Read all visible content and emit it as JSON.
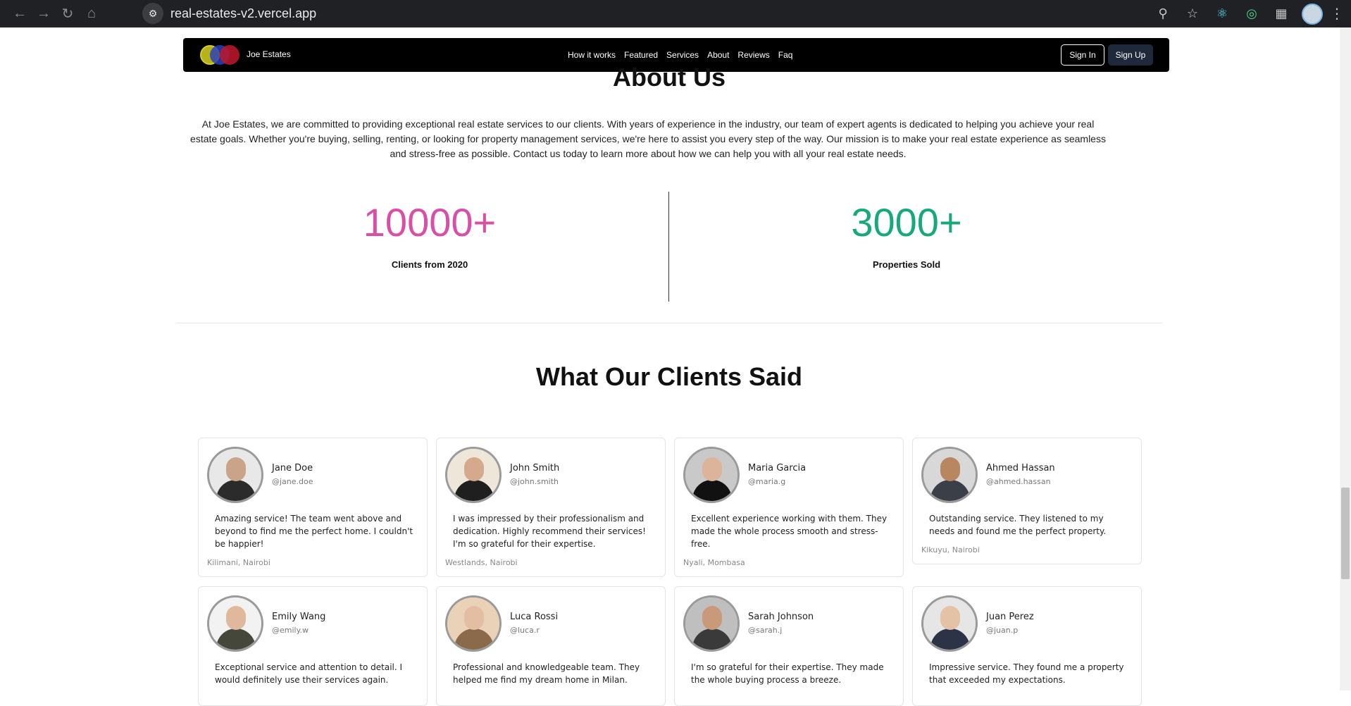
{
  "browser": {
    "url": "real-estates-v2.vercel.app"
  },
  "navbar": {
    "brand": "Joe Estates",
    "links": [
      "How it works",
      "Featured",
      "Services",
      "About",
      "Reviews",
      "Faq"
    ],
    "sign_in": "Sign In",
    "sign_up": "Sign Up"
  },
  "about": {
    "title": "About Us",
    "text": "At Joe Estates, we are committed to providing exceptional real estate services to our clients. With years of experience in the industry, our team of expert agents is dedicated to helping you achieve your real estate goals. Whether you're buying, selling, renting, or looking for property management services, we're here to assist you every step of the way. Our mission is to make your real estate experience as seamless and stress-free as possible. Contact us today to learn more about how we can help you with all your real estate needs.",
    "stats": [
      {
        "value": "10000+",
        "label": "Clients from 2020",
        "color": "#d94fa6"
      },
      {
        "value": "3000+",
        "label": "Properties Sold",
        "color": "#17a97a"
      }
    ]
  },
  "reviews": {
    "title": "What Our Clients Said",
    "items": [
      {
        "name": "Jane Doe",
        "handle": "@jane.doe",
        "quote": "Amazing service! The team went above and beyond to find me the perfect home. I couldn't be happier!",
        "location": "Kilimani, Nairobi"
      },
      {
        "name": "John Smith",
        "handle": "@john.smith",
        "quote": "I was impressed by their professionalism and dedication. Highly recommend their services! I'm so grateful for their expertise.",
        "location": "Westlands, Nairobi"
      },
      {
        "name": "Maria Garcia",
        "handle": "@maria.g",
        "quote": "Excellent experience working with them. They made the whole process smooth and stress-free.",
        "location": "Nyali, Mombasa"
      },
      {
        "name": "Ahmed Hassan",
        "handle": "@ahmed.hassan",
        "quote": "Outstanding service. They listened to my needs and found me the perfect property.",
        "location": "Kikuyu, Nairobi"
      },
      {
        "name": "Emily Wang",
        "handle": "@emily.w",
        "quote": "Exceptional service and attention to detail. I would definitely use their services again.",
        "location": ""
      },
      {
        "name": "Luca Rossi",
        "handle": "@luca.r",
        "quote": "Professional and knowledgeable team. They helped me find my dream home in Milan.",
        "location": ""
      },
      {
        "name": "Sarah Johnson",
        "handle": "@sarah.j",
        "quote": "I'm so grateful for their expertise. They made the whole buying process a breeze.",
        "location": ""
      },
      {
        "name": "Juan Perez",
        "handle": "@juan.p",
        "quote": "Impressive service. They found me a property that exceeded my expectations.",
        "location": ""
      }
    ]
  }
}
